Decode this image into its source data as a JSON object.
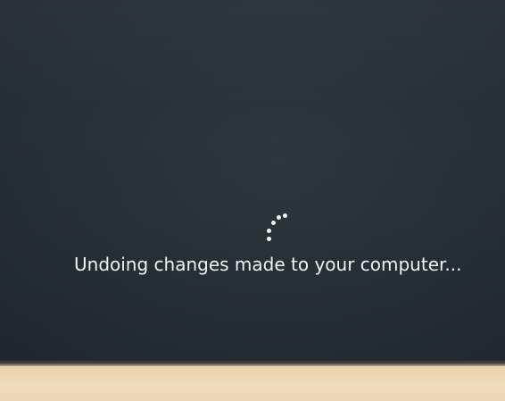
{
  "screen": {
    "status_message": "Undoing changes made to your computer...",
    "spinner_icon": "loading-spinner-icon",
    "colors": {
      "background": "#283236",
      "text": "#f2f2f2"
    }
  }
}
